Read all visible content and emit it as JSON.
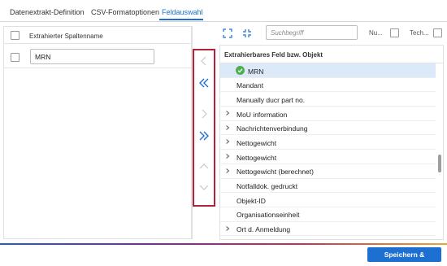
{
  "tabs": [
    {
      "label": "Datenextrakt-Definition"
    },
    {
      "label": "CSV-Formatoptionen"
    },
    {
      "label": "Feldauswahl"
    }
  ],
  "active_tab": "Feldauswahl",
  "left_panel": {
    "header_label": "Extrahierter Spaltenname",
    "rows": [
      {
        "value": "MRN"
      }
    ]
  },
  "transfer_arrows": [
    "chevron-left-icon",
    "double-chevron-left-icon",
    "chevron-right-icon",
    "double-chevron-right-icon",
    "chevron-up-icon",
    "chevron-down-icon"
  ],
  "right_toolbar": {
    "search_placeholder": "Suchbegriff",
    "flag1_label": "Nu...",
    "flag2_label": "Tech..."
  },
  "right_panel": {
    "header_label": "Extrahierbares Feld bzw. Objekt",
    "items": [
      {
        "label": "MRN",
        "expandable": false,
        "selected": true
      },
      {
        "label": "Mandant",
        "expandable": false
      },
      {
        "label": "Manually ducr part no.",
        "expandable": false
      },
      {
        "label": "MoU information",
        "expandable": true
      },
      {
        "label": "Nachrichtenverbindung",
        "expandable": true
      },
      {
        "label": "Nettogewicht",
        "expandable": true
      },
      {
        "label": "Nettogewicht",
        "expandable": true
      },
      {
        "label": "Nettogewicht (berechnet)",
        "expandable": true
      },
      {
        "label": "Notfalldok. gedruckt",
        "expandable": false
      },
      {
        "label": "Objekt-ID",
        "expandable": false
      },
      {
        "label": "Organisationseinheit",
        "expandable": false
      },
      {
        "label": "Ort d. Anmeldung",
        "expandable": true
      }
    ]
  },
  "footer": {
    "save_label": "Speichern & schließen"
  },
  "colors": {
    "accent": "#1d6fd1",
    "highlight_border": "#b2223a",
    "selected_row": "#dce9f8",
    "check_green": "#4caf50"
  }
}
